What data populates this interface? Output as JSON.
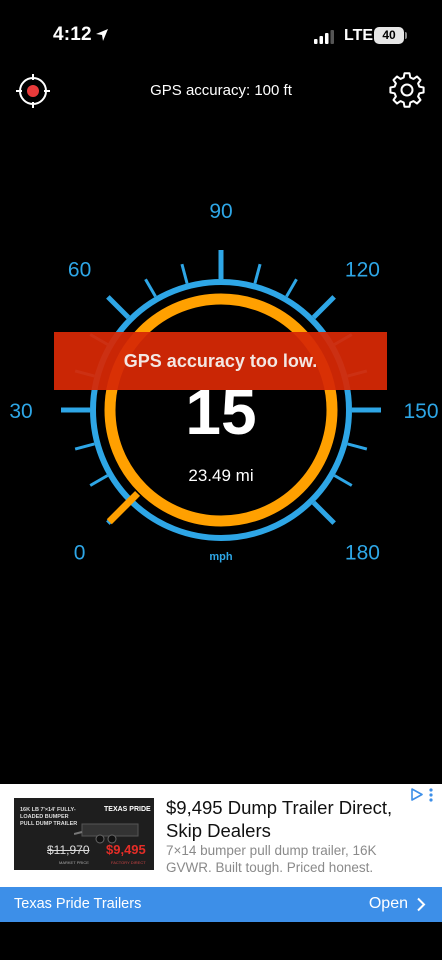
{
  "status_bar": {
    "time": "4:12",
    "carrier": "LTE",
    "battery": "40"
  },
  "header": {
    "title": "GPS accuracy: 100 ft"
  },
  "gauge": {
    "labels": [
      "0",
      "30",
      "60",
      "90",
      "120",
      "150",
      "180"
    ],
    "unit": "mph",
    "min": 0,
    "max": 180,
    "needle_value": 0,
    "speed": "15",
    "distance": "23.49 mi",
    "ring_color": "#2ea6e6",
    "speed_ring_color": "#ffa000"
  },
  "alert": {
    "text": "GPS accuracy too low.",
    "color": "#d72805"
  },
  "ad": {
    "thumb_lines": [
      "16K LB 7'×14' FULLY-",
      "LOADED BUMPER",
      "PULL DUMP TRAILER"
    ],
    "thumb_brand": "TEXAS PRIDE",
    "thumb_old_price": "$11,970",
    "thumb_new_price": "$9,495",
    "thumb_old_caption": "MARKET PRICE",
    "thumb_new_caption": "FACTORY DIRECT",
    "title": "$9,495 Dump Trailer Direct, Skip Dealers",
    "description": "7×14 bumper pull dump trailer, 16K GVWR. Built tough. Priced honest.",
    "advertiser": "Texas Pride Trailers",
    "cta": "Open",
    "bar_color": "#3d8fe8"
  }
}
